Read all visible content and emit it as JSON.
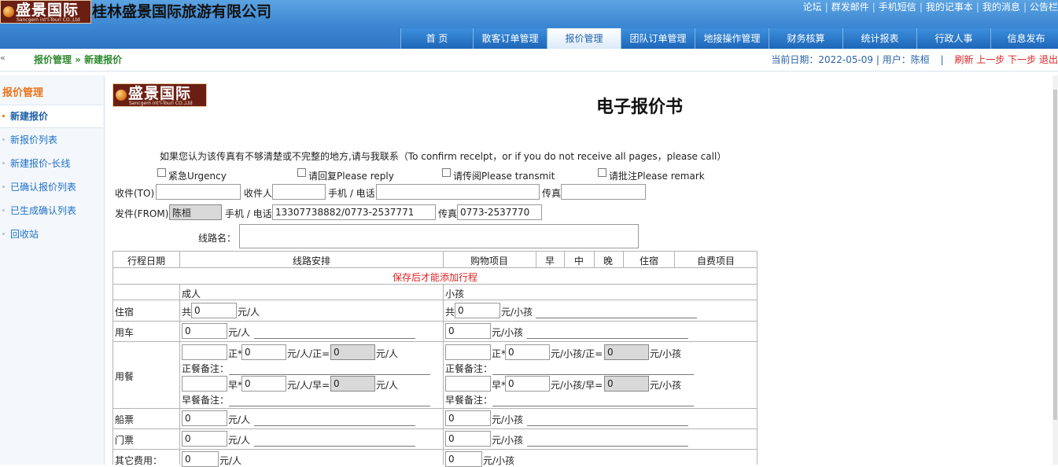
{
  "header": {
    "logo_text": "盛景国际",
    "logo_en": "Sancgem int'l-Touri CO.,Ltd",
    "company": "桂林盛景国际旅游有限公司",
    "top_links": [
      "论坛",
      "群发邮件",
      "手机短信",
      "我的记事本",
      "我的消息",
      "公告栏"
    ],
    "nav": [
      "首 页",
      "散客订单管理",
      "报价管理",
      "团队订单管理",
      "地接操作管理",
      "财务核算",
      "统计报表",
      "行政人事",
      "信息发布"
    ],
    "active_nav": "报价管理"
  },
  "subbar": {
    "arrow": "«",
    "breadcrumb": "报价管理 » 新建报价",
    "date_user": "当前日期：2022-05-09 | 用户：陈桓",
    "sep": "|",
    "refresh": "刷新",
    "prev": "上一步",
    "next": "下一步",
    "logout": "退出"
  },
  "sidebar": {
    "title": "报价管理",
    "items": [
      "新建报价",
      "新报价列表",
      "新建报价-长线",
      "已确认报价列表",
      "已生成确认列表",
      "回收站"
    ]
  },
  "doc": {
    "title": "电子报价书",
    "notice": "如果您认为该传真有不够清楚或不完整的地方,请与我联系（To confirm recelpt，or if you do not receive all pages，please call）",
    "checks": [
      "紧急Urgency",
      "请回复Please reply",
      "请传阅Please transmit",
      "请批注Please remark"
    ],
    "to_label": "收件(TO)",
    "receiver_label": "收件人",
    "phone_label": "手机 / 电话",
    "fax_label": "传真",
    "from_label": "发件(FROM)",
    "from_value": "陈桓",
    "from_phone": "13307738882/0773-2537771",
    "from_fax": "0773-2537770",
    "route_label": "线路名："
  },
  "table": {
    "headers": [
      "行程日期",
      "线路安排",
      "购物项目",
      "早",
      "中",
      "晚",
      "住宿",
      "自费项目"
    ],
    "notice": "保存后才能添加行程",
    "adult": "成人",
    "child": "小孩",
    "rows": {
      "lodging": "住宿",
      "car": "用车",
      "meal": "用餐",
      "boat": "船票",
      "ticket": "门票",
      "other": "其它费用："
    },
    "total_prefix": "共",
    "per_adult": "元/人",
    "per_child": "元/小孩",
    "zero": "0",
    "zheng": "正*",
    "zao": "早*",
    "adult_zheng_eq": "元/人/正=",
    "adult_zao_eq": "元/人/早=",
    "child_zheng_eq": "元/小孩/正=",
    "child_zao_eq": "元/小孩/早=",
    "zheng_note": "正餐备注：",
    "zao_note": "早餐备注："
  }
}
